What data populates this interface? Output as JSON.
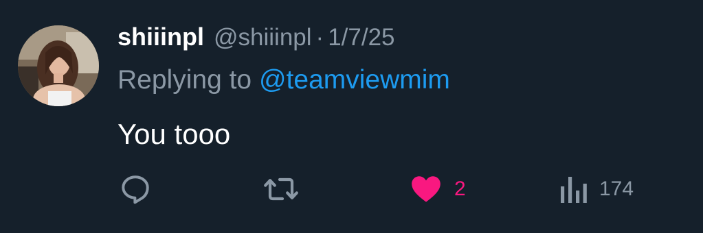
{
  "tweet": {
    "author": {
      "display_name": "shiiinpl",
      "handle": "@shiiinpl",
      "avatar": "avatar-photo"
    },
    "separator": "·",
    "date": "1/7/25",
    "reply_context": {
      "prefix": "Replying to ",
      "mention": "@teamviewmim"
    },
    "text": "You tooo",
    "actions": {
      "reply": {
        "icon": "reply-icon"
      },
      "retweet": {
        "icon": "retweet-icon"
      },
      "like": {
        "icon": "heart-icon",
        "count": "2",
        "liked": true
      },
      "views": {
        "icon": "views-icon",
        "count": "174"
      }
    }
  },
  "colors": {
    "background": "#15202b",
    "primary_text": "#ffffff",
    "secondary_text": "#8b98a5",
    "link": "#1d9bf0",
    "like": "#f91880"
  }
}
